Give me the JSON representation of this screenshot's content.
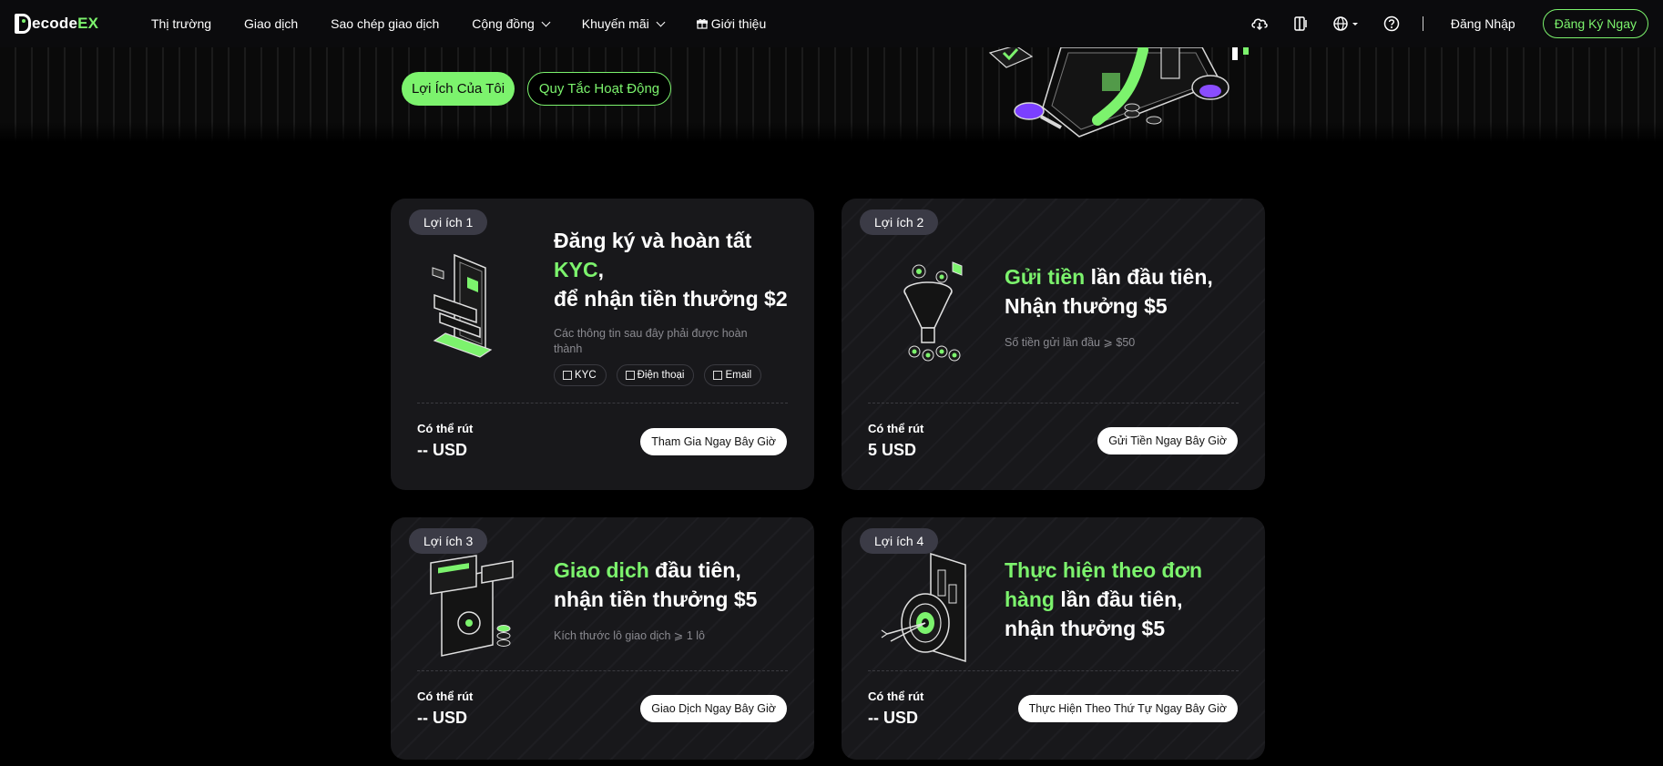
{
  "brand": {
    "logo_main": "ecode",
    "logo_accent": "EX"
  },
  "nav": {
    "markets": "Thị trường",
    "trade": "Giao dịch",
    "copy_trading": "Sao chép giao dịch",
    "community": "Cộng đồng",
    "promotions": "Khuyến mãi",
    "referral": "Giới thiệu",
    "login": "Đăng Nhập",
    "signup": "Đăng Ký Ngay"
  },
  "icons": {
    "download": "cloud-download-icon",
    "theme": "theme-toggle-icon",
    "language": "globe-icon",
    "help": "help-icon",
    "gift": "gift-icon"
  },
  "tabs": {
    "active": "Lợi Ích Của Tôi",
    "rules": "Quy Tắc Hoạt Động"
  },
  "cards": [
    {
      "badge": "Lợi ích 1",
      "title_a": "Đăng ký và hoàn tất",
      "title_hl": "KYC",
      "title_b": ",",
      "title_c": "để nhận tiền thưởng $2",
      "desc": "Các thông tin sau đây phải được hoàn thành",
      "chips": [
        "KYC",
        "Điện thoại",
        "Email"
      ],
      "withdraw_label": "Có thể rút",
      "withdraw_value": "-- USD",
      "cta": "Tham Gia Ngay Bây Giờ"
    },
    {
      "badge": "Lợi ích 2",
      "title_hl": "Gửi tiền",
      "title_a": " lần đầu tiên,",
      "title_b": "Nhận thưởng $5",
      "desc": "Số tiền gửi lần đầu ⩾ $50",
      "withdraw_label": "Có thể rút",
      "withdraw_value": "5 USD",
      "cta": "Gửi Tiền Ngay Bây Giờ"
    },
    {
      "badge": "Lợi ích 3",
      "title_hl": "Giao dịch",
      "title_a": " đầu tiên,",
      "title_b": "nhận tiền thưởng $5",
      "desc": "Kích thước lô giao dịch ⩾ 1 lô",
      "withdraw_label": "Có thể rút",
      "withdraw_value": "-- USD",
      "cta": "Giao Dịch Ngay Bây Giờ"
    },
    {
      "badge": "Lợi ích 4",
      "title_hl": "Thực hiện theo đơn hàng",
      "title_a": " lần đầu tiên,",
      "title_b": "nhận thưởng $5",
      "withdraw_label": "Có thể rút",
      "withdraw_value": "-- USD",
      "cta": "Thực Hiện Theo Thứ Tự Ngay Bây Giờ"
    }
  ],
  "colors": {
    "accent": "#7cf36d",
    "card_bg": "#18181b",
    "page_bg": "#000000"
  }
}
